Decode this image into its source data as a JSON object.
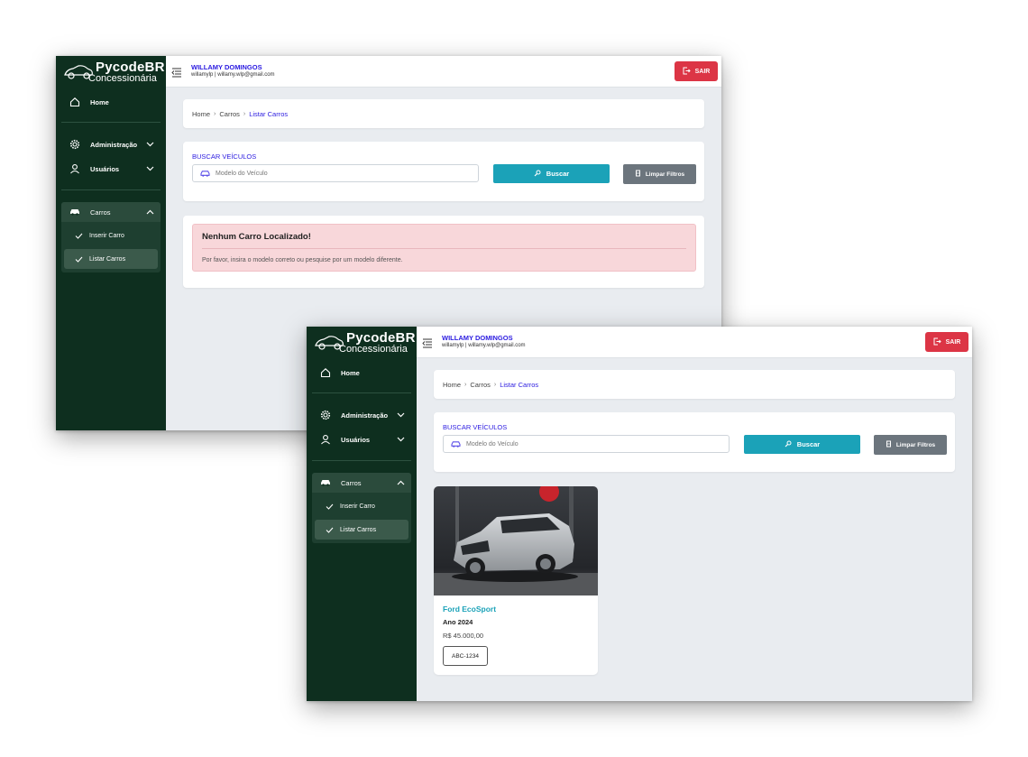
{
  "brand": {
    "name": "PycodeBR",
    "subtitle": "Concessionária"
  },
  "user": {
    "name": "WILLAMY DOMINGOS",
    "info": "willamylp | willamy.wlp@gmail.com"
  },
  "header": {
    "logout_label": "SAIR"
  },
  "sidebar": {
    "home": "Home",
    "administracao": "Administração",
    "usuarios": "Usuários",
    "carros": "Carros",
    "inserir_carro": "Inserir Carro",
    "listar_carros": "Listar Carros"
  },
  "breadcrumb": {
    "items": [
      "Home",
      "Carros",
      "Listar Carros"
    ]
  },
  "search": {
    "title": "BUSCAR VEÍCULOS",
    "placeholder": "Modelo do Veículo",
    "search_label": "Buscar",
    "clear_label": "Limpar Filtros"
  },
  "empty_alert": {
    "title": "Nenhum Carro Localizado!",
    "message": "Por favor, insira o modelo correto ou pesquise por um modelo diferente."
  },
  "car": {
    "title": "Ford EcoSport",
    "year": "Ano 2024",
    "price": "R$ 45.000,00",
    "plate": "ABC-1234"
  },
  "colors": {
    "sidebar": "#0e2f1f",
    "accent": "#2b1be0",
    "primary_button": "#1ba2b8",
    "danger": "#dc3545",
    "secondary_button": "#6c757d",
    "alert_bg": "#f8d7da"
  },
  "icons": {
    "home": "house-icon",
    "administracao": "gear-icon",
    "usuarios": "user-icon",
    "carros": "car-icon",
    "submenu": "check-icon",
    "logout": "logout-icon",
    "search": "search-icon",
    "clear": "eraser-icon",
    "menu_toggle": "menu-toggle-icon"
  }
}
